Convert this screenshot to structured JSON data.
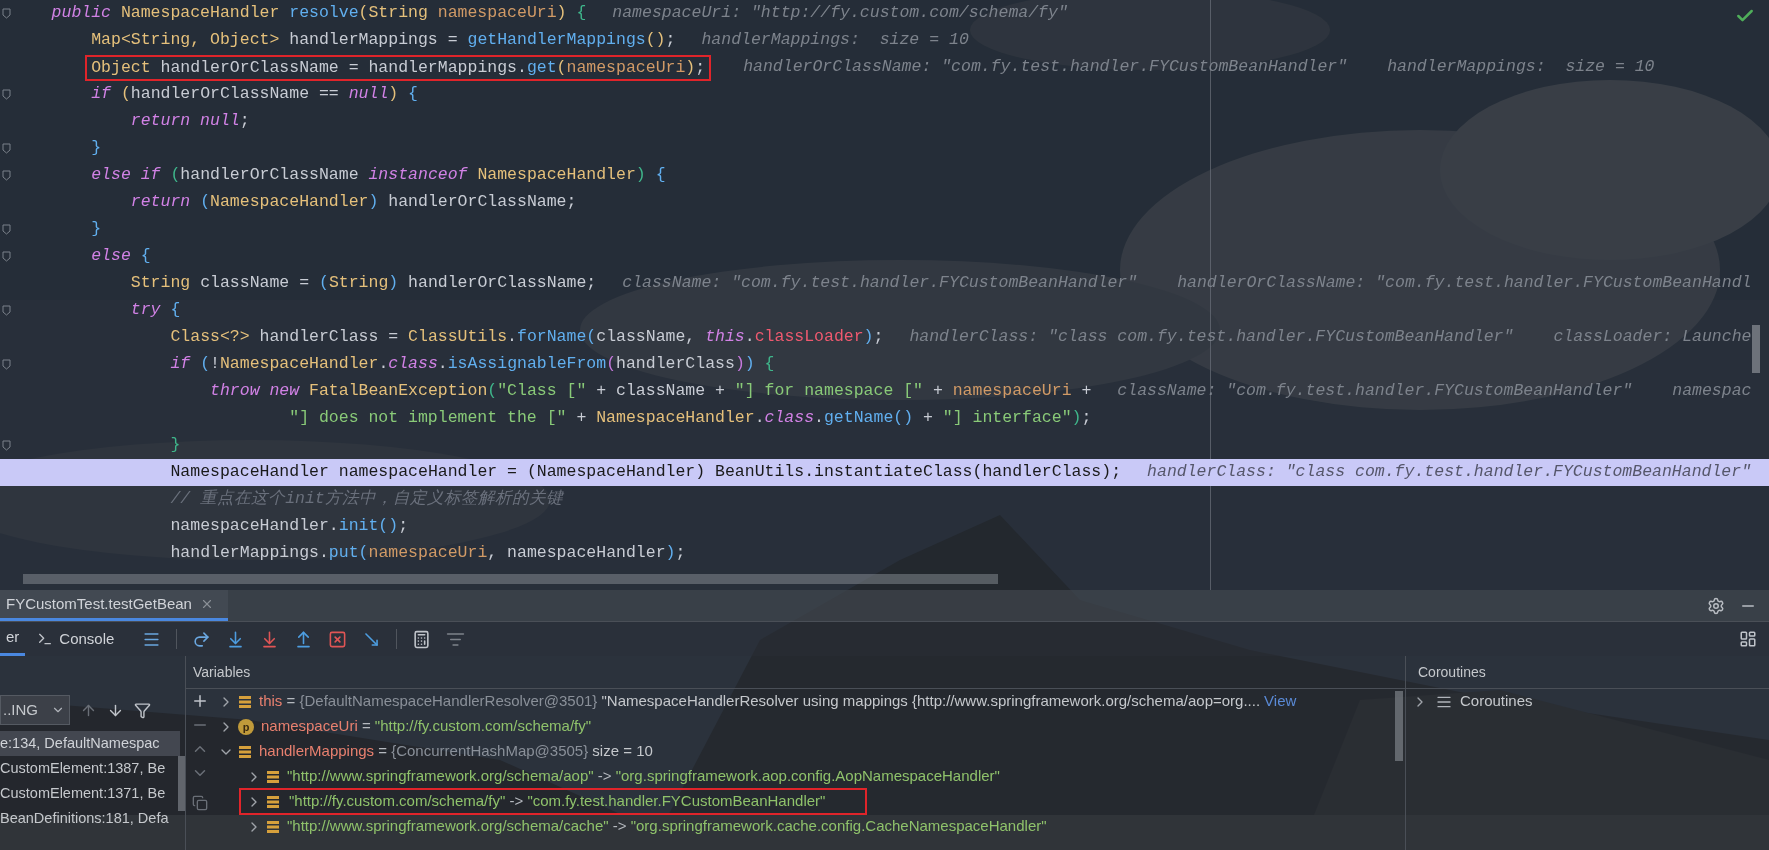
{
  "editor": {
    "lines": [
      {
        "kind": "code",
        "fold": true,
        "boxed": false,
        "current": false,
        "tokens": [
          {
            "kind": "kw",
            "text": "public "
          },
          {
            "kind": "ty",
            "text": "NamespaceHandler "
          },
          {
            "kind": "fn",
            "text": "resolve"
          },
          {
            "kind": "b1",
            "text": "("
          },
          {
            "kind": "ty",
            "text": "String "
          },
          {
            "kind": "pa",
            "text": "namespaceUri"
          },
          {
            "kind": "b1",
            "text": ")"
          },
          {
            "kind": "b2",
            "text": " {"
          }
        ],
        "hints": [
          "namespaceUri: \"http://fy.custom.com/schema/fy\""
        ],
        "children": [
          {
            "kind": "code",
            "fold": false,
            "boxed": false,
            "current": false,
            "tokens": [
              {
                "kind": "ty",
                "text": "Map<String, Object>"
              },
              {
                "kind": "pl",
                "text": " handlerMappings = "
              },
              {
                "kind": "fn",
                "text": "getHandlerMappings"
              },
              {
                "kind": "b1",
                "text": "()"
              },
              {
                "kind": "pl",
                "text": ";"
              }
            ],
            "hints": [
              "handlerMappings:  size = 10"
            ]
          },
          {
            "kind": "code",
            "fold": false,
            "boxed": true,
            "current": false,
            "tokens": [
              {
                "kind": "ty",
                "text": "Object"
              },
              {
                "kind": "pl",
                "text": " handlerOrClassName = handlerMappings."
              },
              {
                "kind": "fn",
                "text": "get"
              },
              {
                "kind": "b1",
                "text": "("
              },
              {
                "kind": "pa",
                "text": "namespaceUri"
              },
              {
                "kind": "b1",
                "text": ")"
              },
              {
                "kind": "pl",
                "text": ";"
              }
            ],
            "hints": [
              "handlerOrClassName: \"com.fy.test.handler.FYCustomBeanHandler\"",
              "handlerMappings:  size = 10"
            ]
          },
          {
            "kind": "code",
            "fold": true,
            "boxed": false,
            "current": false,
            "tokens": [
              {
                "kind": "kw",
                "text": "if "
              },
              {
                "kind": "b1",
                "text": "("
              },
              {
                "kind": "pl",
                "text": "handlerOrClassName == "
              },
              {
                "kind": "kw",
                "text": "null"
              },
              {
                "kind": "b1",
                "text": ")"
              },
              {
                "kind": "b4",
                "text": " {"
              }
            ],
            "children": [
              {
                "kind": "code",
                "fold": false,
                "boxed": false,
                "current": false,
                "tokens": [
                  {
                    "kind": "kw",
                    "text": "return null"
                  },
                  {
                    "kind": "pl",
                    "text": ";"
                  }
                ]
              }
            ]
          },
          {
            "kind": "code",
            "fold": true,
            "boxed": false,
            "current": false,
            "tokens": [
              {
                "kind": "b4",
                "text": "}"
              }
            ]
          },
          {
            "kind": "code",
            "fold": true,
            "boxed": false,
            "current": false,
            "tokens": [
              {
                "kind": "kw",
                "text": "else if "
              },
              {
                "kind": "b2",
                "text": "("
              },
              {
                "kind": "pl",
                "text": "handlerOrClassName "
              },
              {
                "kind": "kw",
                "text": "instanceof "
              },
              {
                "kind": "ty",
                "text": "NamespaceHandler"
              },
              {
                "kind": "b2",
                "text": ")"
              },
              {
                "kind": "b4",
                "text": " {"
              }
            ],
            "children": [
              {
                "kind": "code",
                "fold": false,
                "boxed": false,
                "current": false,
                "tokens": [
                  {
                    "kind": "kw",
                    "text": "return "
                  },
                  {
                    "kind": "b4",
                    "text": "("
                  },
                  {
                    "kind": "ty",
                    "text": "NamespaceHandler"
                  },
                  {
                    "kind": "b4",
                    "text": ")"
                  },
                  {
                    "kind": "pl",
                    "text": " handlerOrClassName;"
                  }
                ]
              }
            ]
          },
          {
            "kind": "code",
            "fold": true,
            "boxed": false,
            "current": false,
            "tokens": [
              {
                "kind": "b4",
                "text": "}"
              }
            ]
          },
          {
            "kind": "code",
            "fold": true,
            "boxed": false,
            "current": false,
            "tokens": [
              {
                "kind": "kw",
                "text": "else "
              },
              {
                "kind": "b4",
                "text": "{"
              }
            ],
            "children": [
              {
                "kind": "code",
                "fold": false,
                "boxed": false,
                "current": false,
                "tokens": [
                  {
                    "kind": "ty",
                    "text": "String"
                  },
                  {
                    "kind": "pl",
                    "text": " className = "
                  },
                  {
                    "kind": "b4",
                    "text": "("
                  },
                  {
                    "kind": "ty",
                    "text": "String"
                  },
                  {
                    "kind": "b4",
                    "text": ")"
                  },
                  {
                    "kind": "pl",
                    "text": " handlerOrClassName;"
                  }
                ],
                "hints": [
                  "className: \"com.fy.test.handler.FYCustomBeanHandler\"",
                  "handlerOrClassName: \"com.fy.test.handler.FYCustomBeanHandl"
                ]
              },
              {
                "kind": "code",
                "fold": true,
                "boxed": false,
                "current": false,
                "tokens": [
                  {
                    "kind": "kw",
                    "text": "try "
                  },
                  {
                    "kind": "b4",
                    "text": "{"
                  }
                ],
                "children": [
                  {
                    "kind": "code",
                    "fold": false,
                    "boxed": false,
                    "current": false,
                    "tokens": [
                      {
                        "kind": "ty",
                        "text": "Class<?>"
                      },
                      {
                        "kind": "pl",
                        "text": " handlerClass = "
                      },
                      {
                        "kind": "ty",
                        "text": "ClassUtils"
                      },
                      {
                        "kind": "pl",
                        "text": "."
                      },
                      {
                        "kind": "fn",
                        "text": "forName"
                      },
                      {
                        "kind": "b4",
                        "text": "("
                      },
                      {
                        "kind": "pl",
                        "text": "className, "
                      },
                      {
                        "kind": "kw",
                        "text": "this"
                      },
                      {
                        "kind": "pl",
                        "text": "."
                      },
                      {
                        "kind": "fd",
                        "text": "classLoader"
                      },
                      {
                        "kind": "b4",
                        "text": ")"
                      },
                      {
                        "kind": "pl",
                        "text": ";"
                      }
                    ],
                    "hints": [
                      "handlerClass: \"class com.fy.test.handler.FYCustomBeanHandler\"",
                      "classLoader: Launche"
                    ]
                  },
                  {
                    "kind": "code",
                    "fold": true,
                    "boxed": false,
                    "current": false,
                    "tokens": [
                      {
                        "kind": "kw",
                        "text": "if "
                      },
                      {
                        "kind": "b4",
                        "text": "("
                      },
                      {
                        "kind": "pl",
                        "text": "!"
                      },
                      {
                        "kind": "ty",
                        "text": "NamespaceHandler"
                      },
                      {
                        "kind": "pl",
                        "text": "."
                      },
                      {
                        "kind": "kw",
                        "text": "class"
                      },
                      {
                        "kind": "pl",
                        "text": "."
                      },
                      {
                        "kind": "fn",
                        "text": "isAssignableFrom"
                      },
                      {
                        "kind": "b3",
                        "text": "("
                      },
                      {
                        "kind": "pl",
                        "text": "handlerClass"
                      },
                      {
                        "kind": "b3",
                        "text": ")"
                      },
                      {
                        "kind": "b4",
                        "text": ")"
                      },
                      {
                        "kind": "b2",
                        "text": " {"
                      }
                    ],
                    "children": [
                      {
                        "kind": "code",
                        "fold": false,
                        "boxed": false,
                        "current": false,
                        "tokens": [
                          {
                            "kind": "kw",
                            "text": "throw new "
                          },
                          {
                            "kind": "ty",
                            "text": "FatalBeanException"
                          },
                          {
                            "kind": "b2",
                            "text": "("
                          },
                          {
                            "kind": "st",
                            "text": "\"Class [\""
                          },
                          {
                            "kind": "pl",
                            "text": " + className + "
                          },
                          {
                            "kind": "st",
                            "text": "\"] for namespace [\""
                          },
                          {
                            "kind": "pl",
                            "text": " + "
                          },
                          {
                            "kind": "pa",
                            "text": "namespaceUri"
                          },
                          {
                            "kind": "pl",
                            "text": " +"
                          }
                        ],
                        "hints": [
                          "className: \"com.fy.test.handler.FYCustomBeanHandler\"",
                          "namespac"
                        ],
                        "children": [
                          {
                            "kind": "continuation",
                            "fold": false,
                            "boxed": false,
                            "current": false,
                            "tokens": [
                              {
                                "kind": "st",
                                "text": "\"] does not implement the [\""
                              },
                              {
                                "kind": "pl",
                                "text": " + "
                              },
                              {
                                "kind": "ty",
                                "text": "NamespaceHandler"
                              },
                              {
                                "kind": "pl",
                                "text": "."
                              },
                              {
                                "kind": "kw",
                                "text": "class"
                              },
                              {
                                "kind": "pl",
                                "text": "."
                              },
                              {
                                "kind": "fn",
                                "text": "getName"
                              },
                              {
                                "kind": "b4",
                                "text": "()"
                              },
                              {
                                "kind": "pl",
                                "text": " + "
                              },
                              {
                                "kind": "st",
                                "text": "\"] interface\""
                              },
                              {
                                "kind": "b2",
                                "text": ")"
                              },
                              {
                                "kind": "pl",
                                "text": ";"
                              }
                            ]
                          }
                        ]
                      }
                    ]
                  },
                  {
                    "kind": "code",
                    "fold": true,
                    "boxed": false,
                    "current": false,
                    "tokens": [
                      {
                        "kind": "b2",
                        "text": "}"
                      }
                    ]
                  },
                  {
                    "kind": "code",
                    "fold": false,
                    "boxed": false,
                    "current": true,
                    "tokens": [
                      {
                        "kind": "ty",
                        "text": "NamespaceHandler"
                      },
                      {
                        "kind": "pl",
                        "text": " namespaceHandler = "
                      },
                      {
                        "kind": "b4",
                        "text": "("
                      },
                      {
                        "kind": "ty",
                        "text": "NamespaceHandler"
                      },
                      {
                        "kind": "b4",
                        "text": ")"
                      },
                      {
                        "kind": "ty",
                        "text": " BeanUtils"
                      },
                      {
                        "kind": "pl",
                        "text": "."
                      },
                      {
                        "kind": "fn",
                        "text": "instantiateClass"
                      },
                      {
                        "kind": "b4",
                        "text": "("
                      },
                      {
                        "kind": "pl",
                        "text": "handlerClass"
                      },
                      {
                        "kind": "b4",
                        "text": ")"
                      },
                      {
                        "kind": "pl",
                        "text": ";"
                      }
                    ],
                    "hints": [
                      "handlerClass: \"class com.fy.test.handler.FYCustomBeanHandler\""
                    ]
                  },
                  {
                    "kind": "code",
                    "fold": false,
                    "boxed": false,
                    "current": false,
                    "tokens": [
                      {
                        "kind": "cm",
                        "text": "// 重点在这个init方法中，自定义标签解析的关键"
                      }
                    ]
                  },
                  {
                    "kind": "code",
                    "fold": false,
                    "boxed": false,
                    "current": false,
                    "tokens": [
                      {
                        "kind": "pl",
                        "text": "namespaceHandler."
                      },
                      {
                        "kind": "fn",
                        "text": "init"
                      },
                      {
                        "kind": "b4",
                        "text": "()"
                      },
                      {
                        "kind": "pl",
                        "text": ";"
                      }
                    ]
                  },
                  {
                    "kind": "code",
                    "fold": false,
                    "boxed": false,
                    "current": false,
                    "tokens": [
                      {
                        "kind": "pl",
                        "text": "handlerMappings."
                      },
                      {
                        "kind": "fn",
                        "text": "put"
                      },
                      {
                        "kind": "b4",
                        "text": "("
                      },
                      {
                        "kind": "pa",
                        "text": "namespaceUri"
                      },
                      {
                        "kind": "pl",
                        "text": ", namespaceHandler"
                      },
                      {
                        "kind": "b4",
                        "text": ")"
                      },
                      {
                        "kind": "pl",
                        "text": ";"
                      }
                    ]
                  }
                ]
              }
            ]
          }
        ]
      }
    ]
  },
  "run_tab": {
    "title": "FYCustomTest.testGetBean",
    "selected": true
  },
  "debug_tabs": [
    {
      "label": "er",
      "kind": "plain",
      "selected": true
    },
    {
      "label": "Console",
      "kind": "console",
      "selected": false
    }
  ],
  "frames": {
    "thread": "..ING",
    "items": [
      {
        "text": "e:134, DefaultNamespac",
        "selected": true
      },
      {
        "text": "CustomElement:1387, Be",
        "selected": false
      },
      {
        "text": "CustomElement:1371, Be",
        "selected": false
      },
      {
        "text": "BeanDefinitions:181, Defa",
        "selected": false
      }
    ]
  },
  "variables": {
    "title": "Variables",
    "items": [
      {
        "kind": "field",
        "expanded": false,
        "tokens": [
          {
            "kind": "name",
            "text": "this"
          },
          {
            "kind": "pl",
            "text": " = "
          },
          {
            "kind": "ref",
            "text": "{DefaultNamespaceHandlerResolver@3501}"
          },
          {
            "kind": "val",
            "text": " \"NamespaceHandlerResolver using mappings {http://www.springframework.org/schema/aop=org...."
          },
          {
            "kind": "link",
            "text": "View"
          }
        ]
      },
      {
        "kind": "param",
        "badge": "p",
        "expanded": false,
        "tokens": [
          {
            "kind": "name",
            "text": "namespaceUri"
          },
          {
            "kind": "pl",
            "text": " = "
          },
          {
            "kind": "st",
            "text": "\"http://fy.custom.com/schema/fy\""
          }
        ]
      },
      {
        "kind": "field",
        "expanded": true,
        "tokens": [
          {
            "kind": "name",
            "text": "handlerMappings"
          },
          {
            "kind": "pl",
            "text": " = "
          },
          {
            "kind": "ref",
            "text": "{ConcurrentHashMap@3505}"
          },
          {
            "kind": "val",
            "text": " size = 10"
          }
        ],
        "children": [
          {
            "kind": "field",
            "expanded": false,
            "boxed": false,
            "tokens": [
              {
                "kind": "st",
                "text": "\"http://www.springframework.org/schema/aop\""
              },
              {
                "kind": "pl",
                "text": " -> "
              },
              {
                "kind": "st",
                "text": "\"org.springframework.aop.config.AopNamespaceHandler\""
              }
            ]
          },
          {
            "kind": "field",
            "expanded": false,
            "boxed": true,
            "tokens": [
              {
                "kind": "st",
                "text": "\"http://fy.custom.com/schema/fy\""
              },
              {
                "kind": "pl",
                "text": " -> "
              },
              {
                "kind": "st",
                "text": "\"com.fy.test.handler.FYCustomBeanHandler\""
              }
            ]
          },
          {
            "kind": "field",
            "expanded": false,
            "boxed": false,
            "tokens": [
              {
                "kind": "st",
                "text": "\"http://www.springframework.org/schema/cache\""
              },
              {
                "kind": "pl",
                "text": " -> "
              },
              {
                "kind": "st",
                "text": "\"org.springframework.cache.config.CacheNamespaceHandler\""
              }
            ]
          }
        ]
      }
    ]
  },
  "coroutines": {
    "title": "Coroutines",
    "items": [
      {
        "label": "Coroutines",
        "expanded": false
      }
    ]
  }
}
